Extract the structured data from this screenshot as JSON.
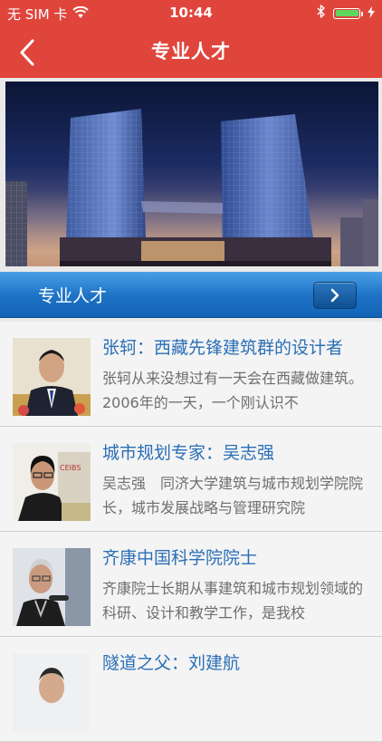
{
  "status_bar": {
    "carrier": "无 SIM 卡",
    "time": "10:44",
    "battery_level": 1.0
  },
  "nav": {
    "title": "专业人才"
  },
  "section": {
    "label": "专业人才"
  },
  "items": [
    {
      "title": "张轲：西藏先锋建筑群的设计者",
      "desc": "张轲从来没想过有一天会在西藏做建筑。2006年的一天，一个刚认识不"
    },
    {
      "title": "城市规划专家：吴志强",
      "desc": "吴志强　同济大学建筑与城市规划学院院长，城市发展战略与管理研究院"
    },
    {
      "title": "齐康中国科学院院士",
      "desc": "齐康院士长期从事建筑和城市规划领域的科研、设计和教学工作，是我校"
    },
    {
      "title": "隧道之父：刘建航",
      "desc": ""
    }
  ],
  "colors": {
    "nav_red": "#e0453c",
    "section_blue": "#1f74c7",
    "link_blue": "#2a6fb6"
  }
}
